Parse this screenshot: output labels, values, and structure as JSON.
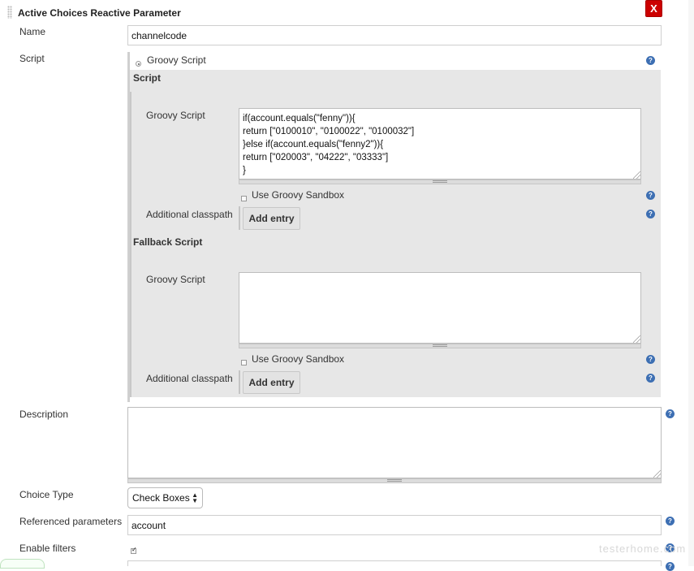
{
  "panel": {
    "title": "Active Choices Reactive Parameter",
    "close_label": "X"
  },
  "name": {
    "label": "Name",
    "value": "channelcode"
  },
  "script": {
    "label": "Script",
    "radio_label": "Groovy Script",
    "section_title": "Script",
    "groovy_label": "Groovy Script",
    "code": "if(account.equals(\"fenny\")){\nreturn [\"0100010\", \"0100022\", \"0100032\"]\n}else if(account.equals(\"fenny2\")){\nreturn [\"020003\", \"04222\", \"03333\"]\n}",
    "sandbox_label": "Use Groovy Sandbox",
    "classpath_label": "Additional classpath",
    "add_entry_label": "Add entry"
  },
  "fallback": {
    "section_title": "Fallback Script",
    "groovy_label": "Groovy Script",
    "code": "",
    "sandbox_label": "Use Groovy Sandbox",
    "classpath_label": "Additional classpath",
    "add_entry_label": "Add entry"
  },
  "description": {
    "label": "Description",
    "value": ""
  },
  "choice_type": {
    "label": "Choice Type",
    "selected": "Check Boxes"
  },
  "referenced": {
    "label": "Referenced parameters",
    "value": "account"
  },
  "filters": {
    "label": "Enable filters"
  },
  "help_glyph": "?",
  "watermark": "testerhome.com",
  "colors": {
    "close": "#cc0000",
    "help": "#3d6fb3",
    "panel": "#e7e7e7"
  }
}
